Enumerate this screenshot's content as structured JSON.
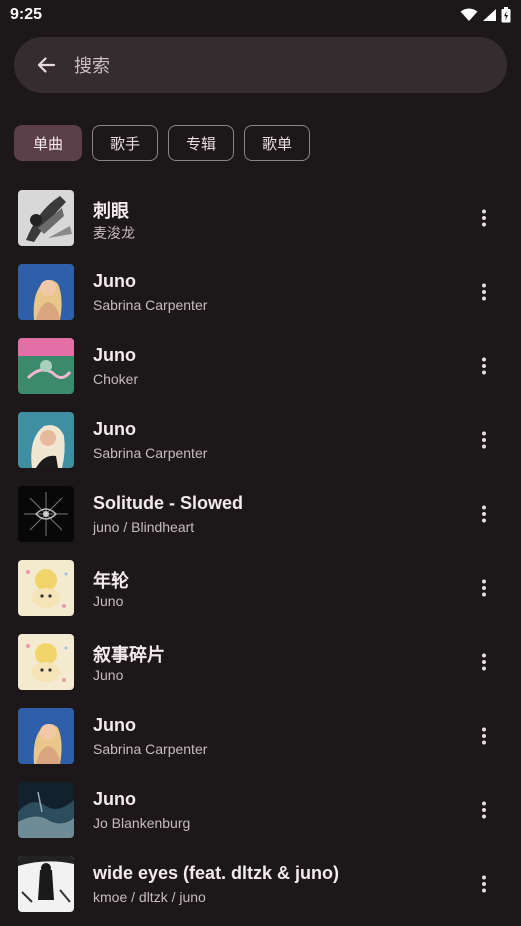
{
  "status_bar": {
    "time": "9:25"
  },
  "search": {
    "placeholder": "搜索"
  },
  "filters": [
    {
      "label": "单曲",
      "selected": true
    },
    {
      "label": "歌手",
      "selected": false
    },
    {
      "label": "专辑",
      "selected": false
    },
    {
      "label": "歌单",
      "selected": false
    }
  ],
  "songs": [
    {
      "title": "刺眼",
      "artist": "麦浚龙",
      "art": "bw-feathers"
    },
    {
      "title": "Juno",
      "artist": "Sabrina Carpenter",
      "art": "blue-blonde"
    },
    {
      "title": "Juno",
      "artist": "Choker",
      "art": "pink-green"
    },
    {
      "title": "Juno",
      "artist": "Sabrina Carpenter",
      "art": "teal-blonde"
    },
    {
      "title": "Solitude - Slowed",
      "artist": "juno / Blindheart",
      "art": "black-sigil"
    },
    {
      "title": "年轮",
      "artist": "Juno",
      "art": "cream-bear"
    },
    {
      "title": "叙事碎片",
      "artist": "Juno",
      "art": "cream-bear"
    },
    {
      "title": "Juno",
      "artist": "Sabrina Carpenter",
      "art": "blue-blonde"
    },
    {
      "title": "Juno",
      "artist": "Jo Blankenburg",
      "art": "dark-wave"
    },
    {
      "title": "wide eyes (feat. dltzk & juno)",
      "artist": "kmoe / dltzk / juno",
      "art": "bw-figure"
    }
  ],
  "colors": {
    "background": "#1c1719",
    "search_bg": "#342c2e",
    "chip_selected": "#5b3f48"
  }
}
